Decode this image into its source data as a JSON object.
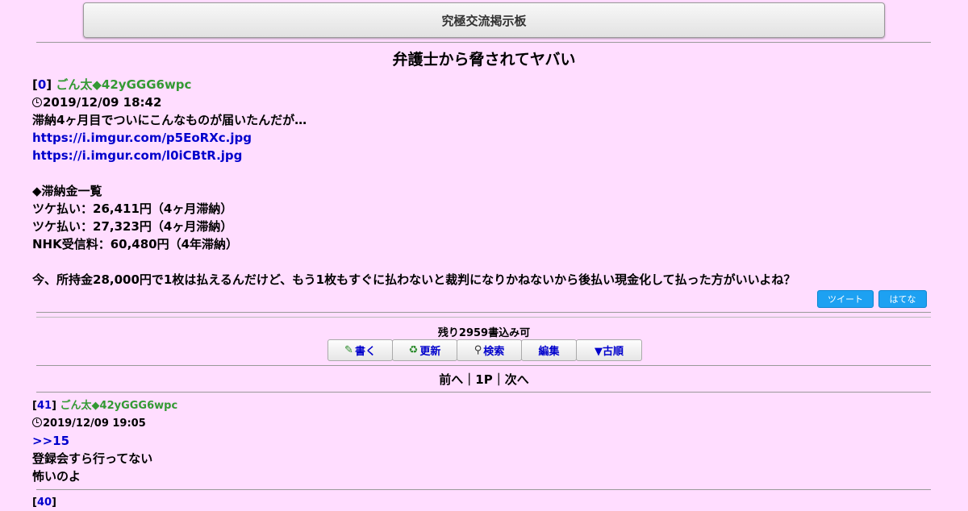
{
  "board": {
    "title": "究極交流掲示板"
  },
  "thread": {
    "title": "弁護士から脅されてヤバい"
  },
  "post0": {
    "num_open": "[",
    "num": "0",
    "num_close": "]",
    "poster": "ごん太◆42yGGG6wpc",
    "date": "2019/12/09 18:42",
    "lines": [
      "滞納4ヶ月目でついにこんなものが届いたんだが…",
      "https://i.imgur.com/p5EoRXc.jpg",
      "https://i.imgur.com/l0iCBtR.jpg",
      "◆滞納金一覧",
      "ツケ払い：26,411円（4ヶ月滞納）",
      "ツケ払い：27,323円（4ヶ月滞納）",
      "NHK受信料：60,480円（4年滞納）",
      "今、所持金28,000円で1枚は払えるんだけど、もう1枚もすぐに払わないと裁判になりかねないから後払い現金化して払った方がいいよね？"
    ]
  },
  "share": {
    "tweet": "ツイート",
    "hatena": "はてな"
  },
  "remaining": "残り2959書込み可",
  "toolbar": {
    "write": "書く",
    "refresh": "更新",
    "search": "検索",
    "edit": "編集",
    "order": "▼古順"
  },
  "pager": {
    "prev": "前へ",
    "sep1": "｜",
    "page": "1P",
    "sep2": "｜",
    "next": "次へ"
  },
  "post41": {
    "num_open": "[",
    "num": "41",
    "num_close": "]",
    "poster": "ごん太◆42yGGG6wpc",
    "date": "2019/12/09 19:05",
    "anchor": ">>15",
    "lines": [
      "登録会すら行ってない",
      "怖いのよ"
    ]
  },
  "post40": {
    "num_open": "[",
    "num": "40",
    "num_close": "]"
  },
  "colors": {
    "background": "#ffddff",
    "link": "#0000cc",
    "poster": "#339933",
    "share": "#1da1f2"
  }
}
